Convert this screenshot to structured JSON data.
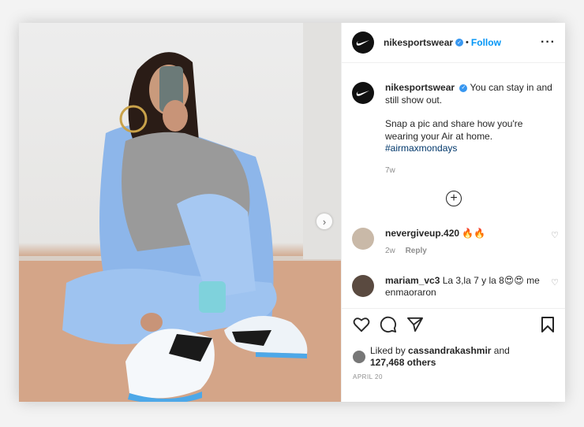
{
  "post": {
    "account": "nikesportswear",
    "verified_mark": "✓",
    "separator": "•",
    "follow_label": "Follow",
    "more_label": "···",
    "caption_line1": "You can stay in and still show out.",
    "caption_line2": "Snap a pic and share how you're wearing your Air at home.",
    "hashtag": "#airmaxmondays",
    "caption_time": "7w",
    "add_comments_label": "+",
    "next_label": "›"
  },
  "comments": [
    {
      "user": "nevergiveup.420",
      "text": "🔥🔥",
      "time": "2w",
      "reply_label": "Reply",
      "heart": "♡"
    },
    {
      "user": "mariam_vc3",
      "text": "La 3,la 7 y la 8😍😍 me enmaoraron",
      "heart": "♡"
    }
  ],
  "likes": {
    "prefix": "Liked by",
    "liker": "cassandrakashmir",
    "and": "and",
    "others": "127,468 others"
  },
  "date": "APRIL 20",
  "icons": [
    "nike-logo-icon",
    "heart-icon",
    "comment-icon",
    "share-icon",
    "bookmark-icon",
    "chevron-right-icon",
    "add-circle-icon"
  ],
  "colors": {
    "link": "#0095f6",
    "verified": "#3897f0",
    "text": "#262626",
    "muted": "#8e8e8e",
    "jacket": "#8db6ea"
  }
}
